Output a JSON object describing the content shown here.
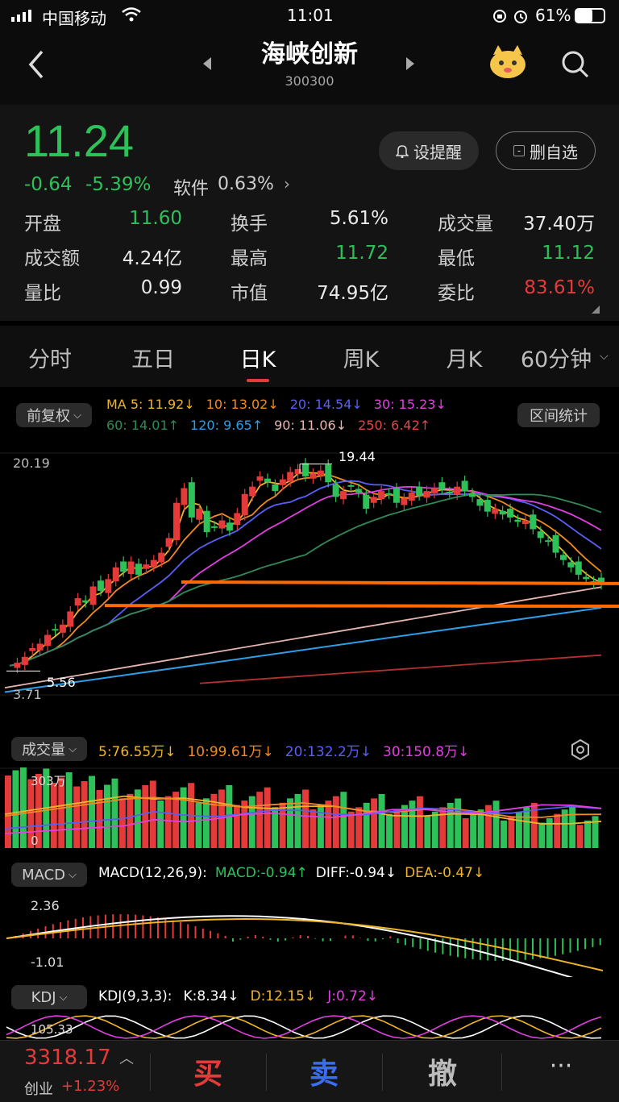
{
  "status_bar": {
    "carrier": "中国移动",
    "time": "11:01",
    "battery": "61%"
  },
  "header": {
    "title": "海峡创新",
    "code": "300300",
    "back_icon": "chevron-left-icon",
    "search_icon": "search-icon",
    "mascot_icon": "mascot-icon"
  },
  "quote": {
    "price": "11.24",
    "change": "-0.64",
    "change_pct": "-5.39%",
    "sector_name": "软件",
    "sector_pct": "0.63%",
    "alert_button": "设提醒",
    "watch_button": "删自选",
    "stats": [
      [
        {
          "label": "开盘",
          "value": "11.60",
          "color": "green"
        },
        {
          "label": "换手",
          "value": "5.61%",
          "color": "white"
        },
        {
          "label": "成交量",
          "value": "37.40万",
          "color": "white"
        }
      ],
      [
        {
          "label": "成交额",
          "value": "4.24亿",
          "color": "white"
        },
        {
          "label": "最高",
          "value": "11.72",
          "color": "green"
        },
        {
          "label": "最低",
          "value": "11.12",
          "color": "green"
        }
      ],
      [
        {
          "label": "量比",
          "value": "0.99",
          "color": "white"
        },
        {
          "label": "市值",
          "value": "74.95亿",
          "color": "white"
        },
        {
          "label": "委比",
          "value": "83.61%",
          "color": "red"
        }
      ]
    ]
  },
  "tabs": {
    "items": [
      "分时",
      "五日",
      "日K",
      "周K",
      "月K",
      "60分钟"
    ],
    "active": "日K"
  },
  "kline": {
    "adjust_label": "前复权",
    "range_stats_label": "区间统计",
    "ma_row1": [
      {
        "text": "MA 5: 11.92↓",
        "color": "#f0b429"
      },
      {
        "text": "10: 13.02↓",
        "color": "#f08a24"
      },
      {
        "text": "20: 14.54↓",
        "color": "#5a5ff5"
      },
      {
        "text": "30: 15.23↓",
        "color": "#e040e0"
      }
    ],
    "ma_row2": [
      {
        "text": "60: 14.01↑",
        "color": "#2e8b57"
      },
      {
        "text": "120: 9.65↑",
        "color": "#2e9ee6"
      },
      {
        "text": "90: 11.06↓",
        "color": "#e8b6b0"
      },
      {
        "text": "250: 6.42↑",
        "color": "#e04848"
      }
    ],
    "axis_high": "20.19",
    "axis_low": "3.71",
    "peak_label": "19.44",
    "trough_label": "5.56"
  },
  "volume": {
    "label": "成交量",
    "items": [
      {
        "text": "5:76.55万↓",
        "color": "#f0b429"
      },
      {
        "text": "10:99.61万↓",
        "color": "#f08a24"
      },
      {
        "text": "20:132.2万↓",
        "color": "#5a5ff5"
      },
      {
        "text": "30:150.8万↓",
        "color": "#e040e0"
      }
    ],
    "axis_top": "303万",
    "axis_zero": "0",
    "settings_icon": "gear-icon"
  },
  "macd": {
    "label": "MACD",
    "items": [
      {
        "text": "MACD(12,26,9):",
        "color": "#ffffff"
      },
      {
        "text": "MACD:-0.94↑",
        "color": "#2ec15a"
      },
      {
        "text": "DIFF:-0.94↓",
        "color": "#ffffff"
      },
      {
        "text": "DEA:-0.47↓",
        "color": "#f0b429"
      }
    ],
    "axis_top": "2.36",
    "axis_bottom": "-1.01"
  },
  "kdj": {
    "label": "KDJ",
    "items": [
      {
        "text": "KDJ(9,3,3):",
        "color": "#ffffff"
      },
      {
        "text": "K:8.34↓",
        "color": "#ffffff"
      },
      {
        "text": "D:12.15↓",
        "color": "#f0b429"
      },
      {
        "text": "J:0.72↓",
        "color": "#e040e0"
      }
    ],
    "axis_top": "105.33"
  },
  "bottom_bar": {
    "index_value": "3318.17",
    "index_name": "创业",
    "index_change": "+1.23%",
    "buy": "买",
    "sell": "卖",
    "cancel": "撤",
    "more": "···"
  },
  "colors": {
    "up": "#e53a3a",
    "down": "#2ec15a",
    "accent": "#ff6a00"
  }
}
